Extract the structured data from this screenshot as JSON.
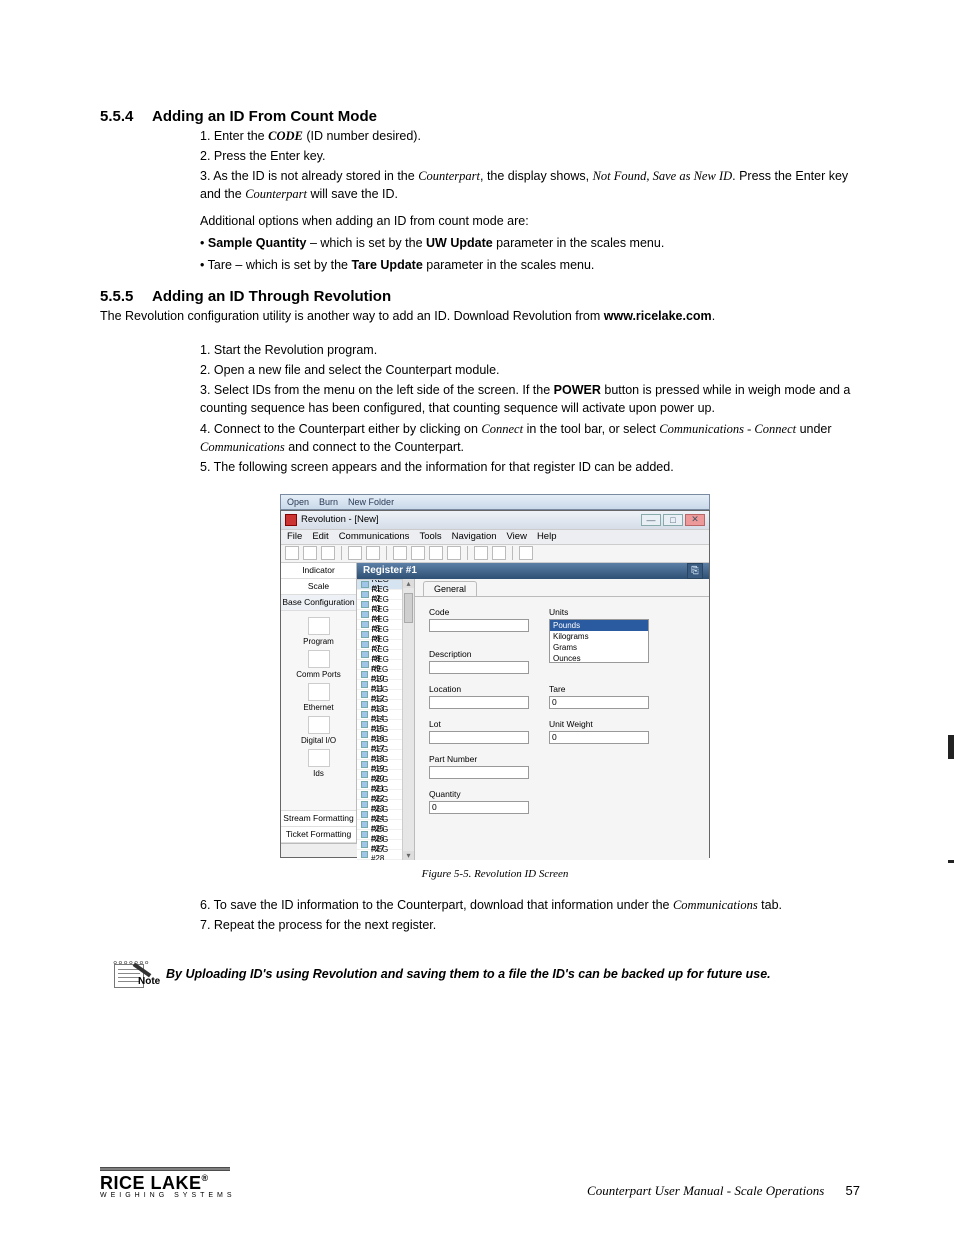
{
  "section554": {
    "num": "5.5.4",
    "title": "Adding an ID From Count Mode",
    "line1_a": "1. Enter the ",
    "line1_b": "CODE",
    "line1_c": " (ID number desired).",
    "line2": "2. Press the Enter key.",
    "line3_a": "3. As the ID is not already stored in the ",
    "line3_b": "Counterpart",
    "line3_c": ", the display shows, ",
    "line3_d": "Not Found, Save as New ID",
    "line3_e": ". Press the Enter key and the ",
    "line3_f": "Counterpart",
    "line3_g": " will save the ID.",
    "opts_intro": "Additional options when adding an ID from count mode are:",
    "opt1_a": "• ",
    "opt1_b": "Sample Quantity",
    "opt1_c": " – which is set by the ",
    "opt1_d": "UW Update",
    "opt1_e": " parameter in the scales menu.",
    "opt2_a": "• Tare – which is set by the ",
    "opt2_b": "Tare Update",
    "opt2_c": " parameter in the scales menu."
  },
  "section555": {
    "num": "5.5.5",
    "title": "Adding an ID Through Revolution",
    "intro_a": "The Revolution configuration utility is another way to add an ID. Download Revolution from ",
    "intro_b": "www.ricelake.com",
    "intro_c": ".",
    "s1": "1. Start the Revolution program.",
    "s2": "2. Open a new file and select the Counterpart module.",
    "s3_a": "3. Select IDs from the menu on the left side of the screen. If the ",
    "s3_b": "POWER",
    "s3_c": " button is pressed while in weigh mode and a counting sequence has been configured, that counting sequence will activate upon power up.",
    "s4_a": "4. Connect to the Counterpart either by clicking on ",
    "s4_b": "Connect",
    "s4_c": " in the tool bar, or select ",
    "s4_d": "Communications - Connect",
    "s4_e": " under ",
    "s4_f": "Communications",
    "s4_g": " and connect to the Counterpart.",
    "s5": "5. The following screen appears and the information for that register ID can be added.",
    "s6_a": "6. To save the ID information to the Counterpart, download that information under the ",
    "s6_b": "Communications",
    "s6_c": " tab.",
    "s7": "7. Repeat the process for the next register."
  },
  "fig": {
    "desk_open": "Open",
    "desk_burn": "Burn",
    "desk_new": "New Folder",
    "title": "Revolution - [New]",
    "menu": [
      "File",
      "Edit",
      "Communications",
      "Tools",
      "Navigation",
      "View",
      "Help"
    ],
    "left": {
      "indicator": "Indicator",
      "scale": "Scale",
      "base": "Base Configuration",
      "program": "Program",
      "comm": "Comm Ports",
      "eth": "Ethernet",
      "dio": "Digital I/O",
      "ids": "Ids",
      "stream": "Stream Formatting",
      "ticket": "Ticket Formatting"
    },
    "header": "Register #1",
    "regs": [
      "REG #1",
      "REG #2",
      "REG #3",
      "REG #4",
      "REG #5",
      "REG #6",
      "REG #7",
      "REG #8",
      "REG #9",
      "REG #10",
      "REG #11",
      "REG #12",
      "REG #13",
      "REG #14",
      "REG #15",
      "REG #16",
      "REG #17",
      "REG #18",
      "REG #19",
      "REG #20",
      "REG #21",
      "REG #22",
      "REG #23",
      "REG #24",
      "REG #25",
      "REG #26",
      "REG #27",
      "REG #28"
    ],
    "tab": "General",
    "labels": {
      "code": "Code",
      "desc": "Description",
      "loc": "Location",
      "lot": "Lot",
      "part": "Part Number",
      "qty": "Quantity",
      "units": "Units",
      "tare": "Tare",
      "uw": "Unit Weight"
    },
    "units": [
      "Pounds",
      "Kilograms",
      "Grams",
      "Ounces"
    ],
    "zero": "0",
    "caption": "Figure 5-5. Revolution ID Screen"
  },
  "note": {
    "label": "Note",
    "text": "By Uploading ID's using Revolution and saving them to a file the ID's can be backed up for future use."
  },
  "footer": {
    "brand": "RICE LAKE",
    "sub": "WEIGHING SYSTEMS",
    "doc": "Counterpart User Manual - Scale Operations",
    "page": "57"
  }
}
